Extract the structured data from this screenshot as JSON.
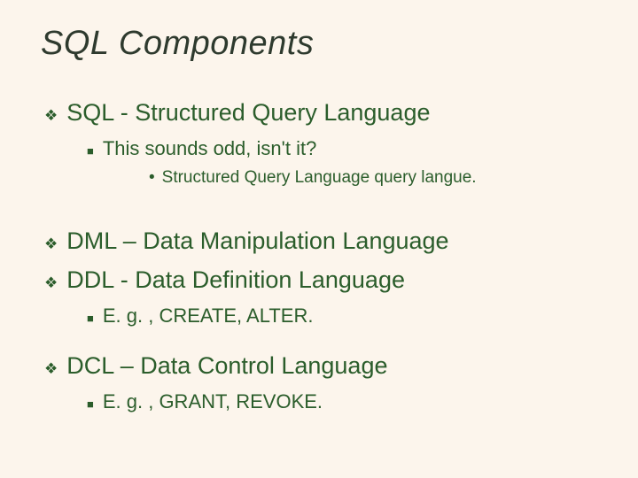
{
  "slide": {
    "title": "SQL Components",
    "items": [
      {
        "text": "SQL - Structured Query Language"
      },
      {
        "text": "This sounds odd, isn't it?"
      },
      {
        "text": "Structured Query Language query langue."
      },
      {
        "text": "DML – Data Manipulation Language"
      },
      {
        "text": "DDL - Data Definition Language"
      },
      {
        "text": "E. g. , CREATE, ALTER."
      },
      {
        "text": "DCL – Data Control Language"
      },
      {
        "text": "E. g. , GRANT, REVOKE."
      }
    ]
  }
}
